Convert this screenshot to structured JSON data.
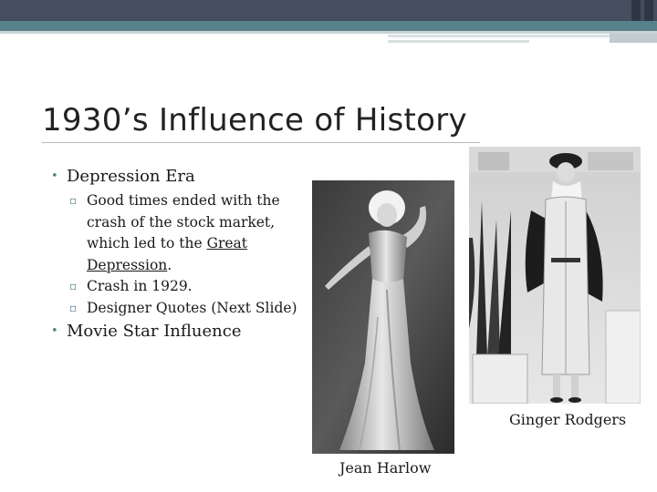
{
  "slide": {
    "title": "1930’s Influence of History",
    "bullets": [
      {
        "text": "Depression Era",
        "sub": [
          {
            "before": "Good times ended with the crash of the stock market, which led to the ",
            "link": "Great Depression",
            "after": "."
          },
          {
            "before": "Crash in 1929.",
            "link": "",
            "after": ""
          },
          {
            "before": "Designer Quotes (Next Slide)",
            "link": "",
            "after": ""
          }
        ]
      },
      {
        "text": "Movie Star Influence"
      }
    ],
    "captions": {
      "harlow": "Jean Harlow",
      "rodgers": "Ginger Rodgers"
    }
  },
  "colors": {
    "accent": "#58828b",
    "top_bar": "#454d5e"
  }
}
